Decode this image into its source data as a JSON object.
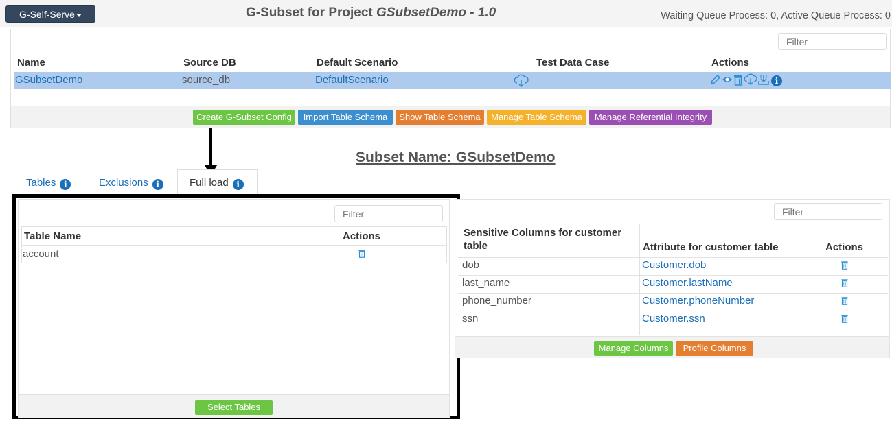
{
  "header": {
    "menu_label": "G-Self-Serve",
    "title_prefix": "G-Subset for Project ",
    "title_project": "GSubsetDemo - 1.0",
    "queue_status": "Waiting Queue Process: 0, Active Queue Process: 0"
  },
  "config_table": {
    "filter_placeholder": "Filter",
    "columns": [
      "Name",
      "Source DB",
      "Default Scenario",
      "Test Data Case",
      "Actions"
    ],
    "rows": [
      {
        "name": "GSubsetDemo",
        "source_db": "source_db",
        "default_scenario": "DefaultScenario",
        "test_data_case_icon": "cloud-download-icon"
      }
    ],
    "action_icons": [
      "pencil-icon",
      "eye-icon",
      "trash-icon",
      "cloud-download-icon",
      "download-icon",
      "info-icon"
    ]
  },
  "toolbar": {
    "create": "Create G-Subset Config",
    "import": "Import Table Schema",
    "show": "Show Table Schema",
    "manage": "Manage Table Schema",
    "referential": "Manage Referential Integrity",
    "colors": {
      "green": "#6cc644",
      "blue": "#3c8fcf",
      "orange": "#e47e30",
      "yellow": "#f3b22a",
      "purple": "#9b4fb3"
    }
  },
  "subset": {
    "label": "Subset Name: GSubsetDemo"
  },
  "tabs": [
    {
      "label": "Tables"
    },
    {
      "label": "Exclusions"
    },
    {
      "label": "Full load"
    }
  ],
  "full_load": {
    "filter_placeholder": "Filter",
    "columns": [
      "Table Name",
      "Actions"
    ],
    "rows": [
      {
        "table": "account"
      }
    ],
    "select_button": "Select Tables"
  },
  "sensitive": {
    "filter_placeholder": "Filter",
    "col1_line1": "Sensitive Columns for customer",
    "col1_line2": "table",
    "col2": "Attribute for customer table",
    "col3": "Actions",
    "rows": [
      {
        "column": "dob",
        "attribute": "Customer.dob"
      },
      {
        "column": "last_name",
        "attribute": "Customer.lastName"
      },
      {
        "column": "phone_number",
        "attribute": "Customer.phoneNumber"
      },
      {
        "column": "ssn",
        "attribute": "Customer.ssn"
      }
    ],
    "manage_button": "Manage Columns",
    "profile_button": "Profile Columns"
  }
}
